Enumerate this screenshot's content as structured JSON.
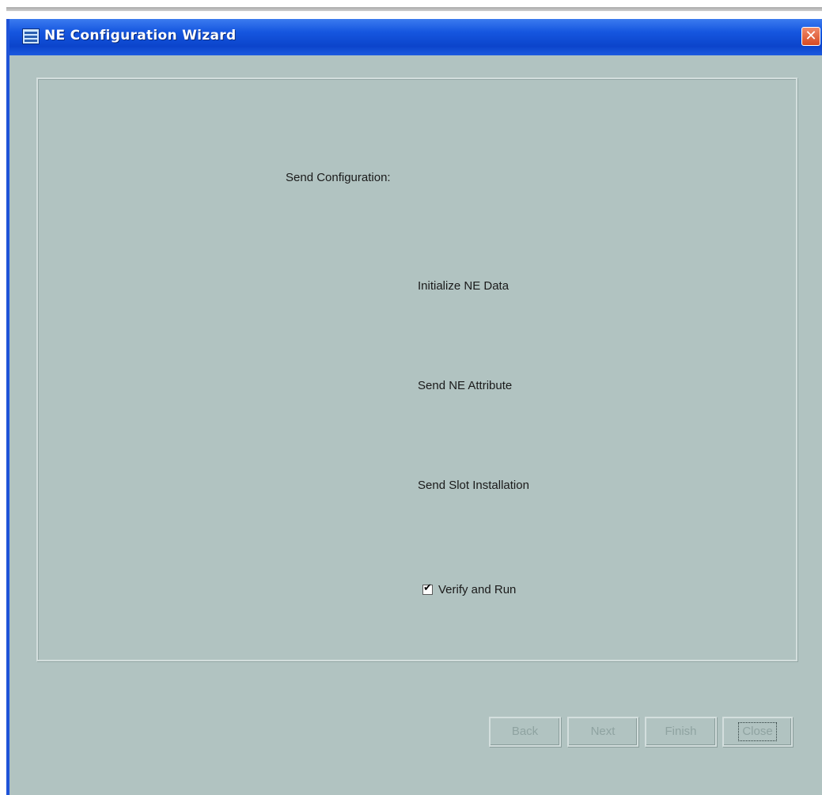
{
  "window": {
    "title": "NE Configuration Wizard",
    "close_glyph": "✕"
  },
  "panel": {
    "heading": "Send Configuration:",
    "steps": [
      "Initialize NE Data",
      "Send NE Attribute",
      "Send Slot Installation"
    ],
    "verify_checkbox": {
      "label": "Verify and Run",
      "checked": true,
      "check_glyph": "✔"
    }
  },
  "buttons": {
    "back": "Back",
    "next": "Next",
    "finish": "Finish",
    "close": "Close"
  },
  "colors": {
    "titlebar": "#0b44cb",
    "window_bg": "#b1c3c1",
    "close_button": "#d64a22",
    "disabled_text": "#8fa3a1"
  }
}
